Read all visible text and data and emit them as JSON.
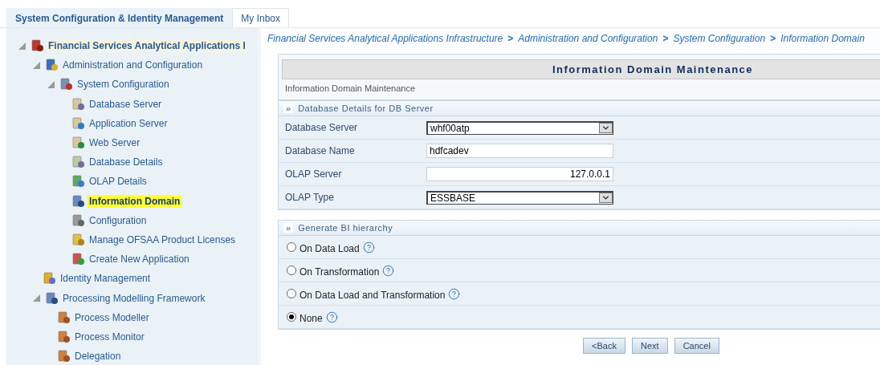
{
  "tabs": [
    {
      "label": "System Configuration & Identity Management",
      "selected": true
    },
    {
      "label": "My Inbox",
      "selected": false
    }
  ],
  "tree": [
    {
      "label": "Financial Services Analytical Applications I",
      "expanded": true,
      "selected": false,
      "children": [
        {
          "label": "Administration and Configuration",
          "expanded": true,
          "selected": false,
          "children": [
            {
              "label": "System Configuration",
              "expanded": true,
              "selected": false,
              "children": [
                {
                  "label": "Database Server",
                  "selected": false
                },
                {
                  "label": "Application Server",
                  "selected": false
                },
                {
                  "label": "Web Server",
                  "selected": false
                },
                {
                  "label": "Database Details",
                  "selected": false
                },
                {
                  "label": "OLAP Details",
                  "selected": false
                },
                {
                  "label": "Information Domain",
                  "selected": true
                },
                {
                  "label": "Configuration",
                  "selected": false
                },
                {
                  "label": "Manage OFSAA Product Licenses",
                  "selected": false
                },
                {
                  "label": "Create New Application",
                  "selected": false
                }
              ]
            }
          ]
        },
        {
          "label": "Identity Management",
          "selected": false
        },
        {
          "label": "Processing Modelling Framework",
          "expanded": true,
          "selected": false,
          "children": [
            {
              "label": "Process Modeller",
              "selected": false
            },
            {
              "label": "Process Monitor",
              "selected": false
            },
            {
              "label": "Delegation",
              "selected": false
            }
          ]
        }
      ]
    }
  ],
  "breadcrumb": {
    "separator": ">",
    "items": [
      "Financial Services Analytical Applications Infrastructure",
      "Administration and Configuration",
      "System Configuration",
      "Information Domain"
    ]
  },
  "form": {
    "title": "Information Domain Maintenance",
    "subtitle": "Information Domain Maintenance",
    "sections": [
      {
        "marker": "»",
        "title": "Database Details for DB Server",
        "fields": [
          {
            "kind": "select",
            "label": "Database Server",
            "value": "whf00atp"
          },
          {
            "kind": "text",
            "label": "Database Name",
            "value": "hdfcadev"
          },
          {
            "kind": "number",
            "label": "OLAP Server",
            "value": "127.0.0.1"
          },
          {
            "kind": "select",
            "label": "OLAP Type",
            "value": "ESSBASE"
          }
        ]
      },
      {
        "marker": "»",
        "title": "Generate BI hierarchy",
        "options": [
          {
            "label": "On Data Load",
            "selected": false
          },
          {
            "label": "On Transformation",
            "selected": false
          },
          {
            "label": "On Data Load and Transformation",
            "selected": false
          },
          {
            "label": "None",
            "selected": true
          }
        ]
      }
    ]
  },
  "buttons": [
    "<Back",
    "Next",
    "Cancel"
  ]
}
